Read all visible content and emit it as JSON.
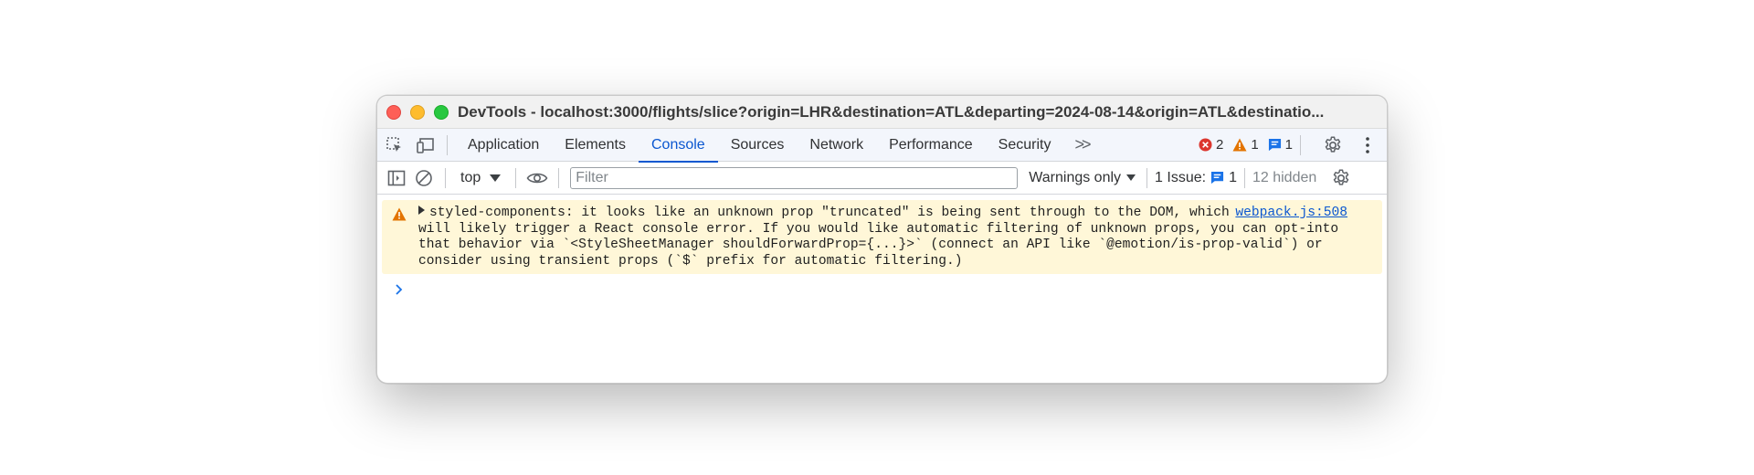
{
  "window": {
    "title": "DevTools - localhost:3000/flights/slice?origin=LHR&destination=ATL&departing=2024-08-14&origin=ATL&destinatio..."
  },
  "tabs": [
    {
      "label": "Application",
      "active": false
    },
    {
      "label": "Elements",
      "active": false
    },
    {
      "label": "Console",
      "active": true
    },
    {
      "label": "Sources",
      "active": false
    },
    {
      "label": "Network",
      "active": false
    },
    {
      "label": "Performance",
      "active": false
    },
    {
      "label": "Security",
      "active": false
    }
  ],
  "counts": {
    "errors": "2",
    "warnings": "1",
    "issues": "1"
  },
  "toolbar": {
    "context": "top",
    "filter_placeholder": "Filter",
    "levels": "Warnings only",
    "issues_label": "1 Issue:",
    "issues_count": "1",
    "hidden": "12 hidden"
  },
  "messages": [
    {
      "level": "warning",
      "text": "styled-components: it looks like an unknown prop \"truncated\" is being sent through to the DOM, which\nwill likely trigger a React console error. If you would like automatic filtering of unknown props, you can opt-into\nthat behavior via `<StyleSheetManager shouldForwardProp={...}>` (connect an API like `@emotion/is-prop-valid`) or\nconsider using transient props (`$` prefix for automatic filtering.)",
      "source": "webpack.js:508"
    }
  ],
  "colors": {
    "accent": "#0b57d0",
    "warning_bg": "#fff7d8",
    "error_icon": "#dc362e",
    "warning_icon": "#e37400"
  }
}
